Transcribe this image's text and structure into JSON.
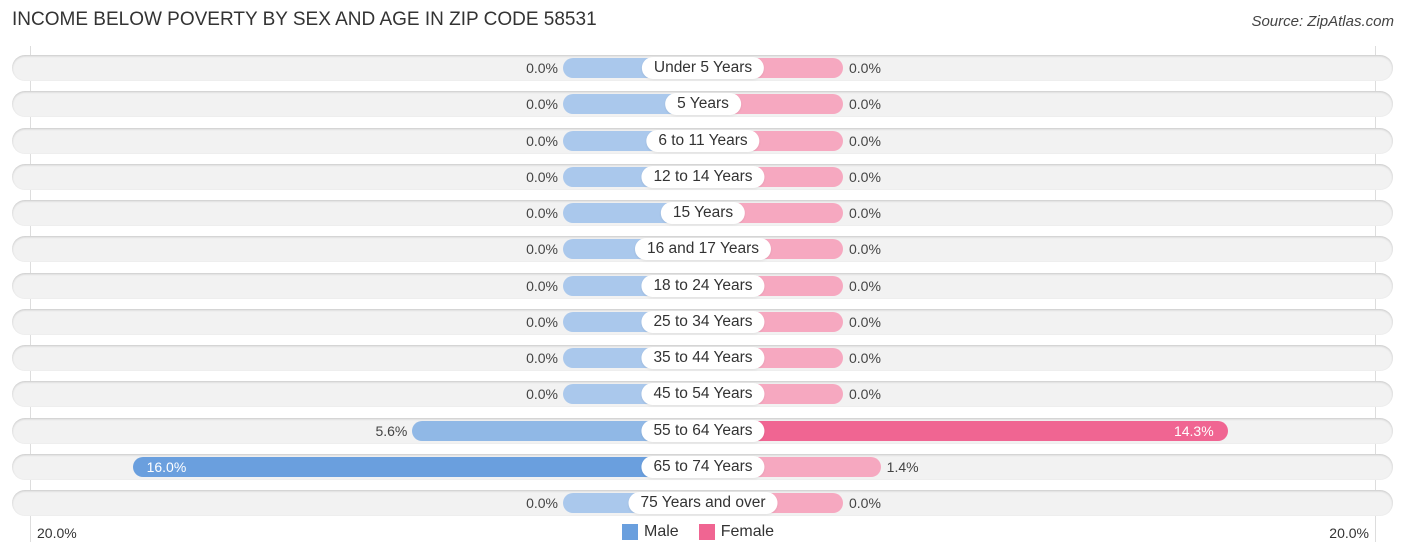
{
  "chart_data": {
    "type": "bar",
    "orientation": "horizontal-diverging",
    "title": "INCOME BELOW POVERTY BY SEX AND AGE IN ZIP CODE 58531",
    "source": "Source: ZipAtlas.com",
    "categories": [
      "Under 5 Years",
      "5 Years",
      "6 to 11 Years",
      "12 to 14 Years",
      "15 Years",
      "16 and 17 Years",
      "18 to 24 Years",
      "25 to 34 Years",
      "35 to 44 Years",
      "45 to 54 Years",
      "55 to 64 Years",
      "65 to 74 Years",
      "75 Years and over"
    ],
    "series": [
      {
        "name": "Male",
        "color": "#6a9fde",
        "light_color": "#aac8ec",
        "values": [
          0.0,
          0.0,
          0.0,
          0.0,
          0.0,
          0.0,
          0.0,
          0.0,
          0.0,
          0.0,
          5.6,
          16.0,
          0.0
        ],
        "labels": [
          "0.0%",
          "0.0%",
          "0.0%",
          "0.0%",
          "0.0%",
          "0.0%",
          "0.0%",
          "0.0%",
          "0.0%",
          "0.0%",
          "5.6%",
          "16.0%",
          "0.0%"
        ]
      },
      {
        "name": "Female",
        "color": "#f06592",
        "light_color": "#f6a8c0",
        "values": [
          0.0,
          0.0,
          0.0,
          0.0,
          0.0,
          0.0,
          0.0,
          0.0,
          0.0,
          0.0,
          14.3,
          1.4,
          0.0
        ],
        "labels": [
          "0.0%",
          "0.0%",
          "0.0%",
          "0.0%",
          "0.0%",
          "0.0%",
          "0.0%",
          "0.0%",
          "0.0%",
          "0.0%",
          "14.3%",
          "1.4%",
          "0.0%"
        ]
      }
    ],
    "axis": {
      "left_label": "20.0%",
      "right_label": "20.0%",
      "range": [
        0,
        20
      ]
    },
    "legend": {
      "position": "bottom-center",
      "items": [
        "Male",
        "Female"
      ]
    }
  }
}
